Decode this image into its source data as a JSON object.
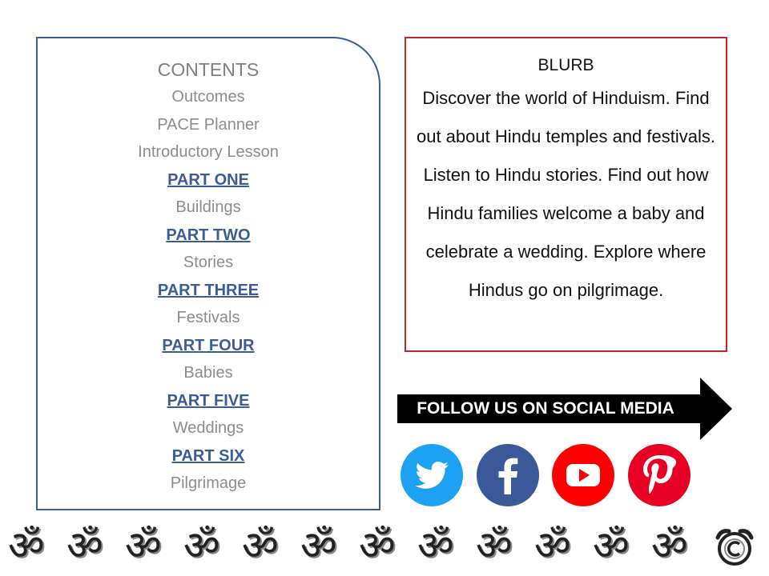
{
  "contents": {
    "heading": "CONTENTS",
    "items": [
      {
        "label": "Outcomes",
        "type": "plain"
      },
      {
        "label": "PACE Planner",
        "type": "plain"
      },
      {
        "label": "Introductory Lesson",
        "type": "plain"
      },
      {
        "label": "PART ONE",
        "type": "part"
      },
      {
        "label": "Buildings",
        "type": "plain"
      },
      {
        "label": "PART TWO",
        "type": "part"
      },
      {
        "label": "Stories",
        "type": "plain"
      },
      {
        "label": "PART THREE",
        "type": "part"
      },
      {
        "label": "Festivals",
        "type": "plain"
      },
      {
        "label": "PART FOUR",
        "type": "part"
      },
      {
        "label": "Babies",
        "type": "plain"
      },
      {
        "label": "PART FIVE",
        "type": "part"
      },
      {
        "label": "Weddings",
        "type": "plain"
      },
      {
        "label": "PART SIX",
        "type": "part"
      },
      {
        "label": "Pilgrimage",
        "type": "plain"
      }
    ]
  },
  "blurb": {
    "title": "BLURB",
    "text": "Discover the world of Hinduism. Find out about Hindu temples and festivals. Listen to Hindu stories. Find out how Hindu families welcome a baby and celebrate a wedding. Explore where Hindus go on pilgrimage."
  },
  "social": {
    "label": "FOLLOW US ON SOCIAL MEDIA",
    "icons": [
      {
        "name": "twitter-icon",
        "color": "#1da1f2"
      },
      {
        "name": "facebook-icon",
        "color": "#3b5998"
      },
      {
        "name": "youtube-icon",
        "color": "#ff0000"
      },
      {
        "name": "pinterest-icon",
        "color": "#e60023"
      }
    ]
  },
  "footer": {
    "om_symbol": "ॐ",
    "om_count": 12,
    "icons": [
      "om-symbol-icon",
      "copyright-icon"
    ]
  },
  "colors": {
    "contents_border": "#3b5d95",
    "part_link": "#3a5d97",
    "blurb_border": "#c0272d",
    "arrow": "#000000"
  }
}
